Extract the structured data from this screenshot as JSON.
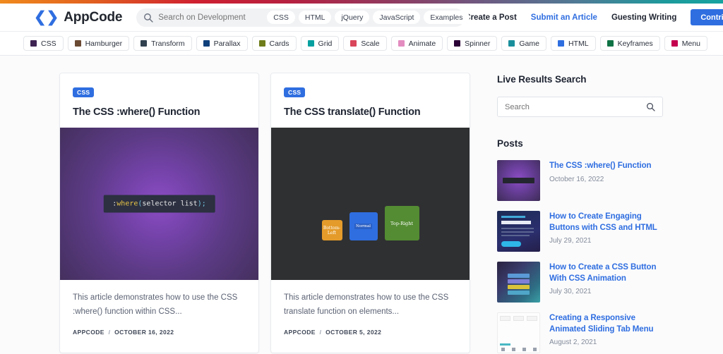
{
  "header": {
    "brand": "AppCode",
    "logo_icon": "code-chevrons-icon",
    "search": {
      "placeholder": "Search on Development",
      "value": "",
      "icon": "search-icon"
    },
    "chips": [
      "CSS",
      "HTML",
      "jQuery",
      "JavaScript",
      "Examples"
    ],
    "nav": [
      {
        "label": "Create a Post",
        "style": "dark"
      },
      {
        "label": "Submit an Article",
        "style": "blue"
      },
      {
        "label": "Guesting Writing",
        "style": "dark"
      }
    ],
    "cta": {
      "label": "Contribute",
      "color": "#2f6ee0"
    }
  },
  "categories": [
    {
      "label": "CSS",
      "color": "#3d2352"
    },
    {
      "label": "Hamburger",
      "color": "#6b4a33"
    },
    {
      "label": "Transform",
      "color": "#31414f"
    },
    {
      "label": "Parallax",
      "color": "#10407c"
    },
    {
      "label": "Cards",
      "color": "#6f7d1a"
    },
    {
      "label": "Grid",
      "color": "#07a0a0"
    },
    {
      "label": "Scale",
      "color": "#d9455a"
    },
    {
      "label": "Animate",
      "color": "#e38cc0"
    },
    {
      "label": "Spinner",
      "color": "#2c0236"
    },
    {
      "label": "Game",
      "color": "#1a8f9c"
    },
    {
      "label": "HTML",
      "color": "#2f6ee0"
    },
    {
      "label": "Keyframes",
      "color": "#0f7245"
    },
    {
      "label": "Menu",
      "color": "#c4004f"
    }
  ],
  "cards": [
    {
      "badge": "CSS",
      "title": "The CSS :where() Function",
      "thumb_kind": "purple-code",
      "code": {
        "colon": ":",
        "keyword": "where",
        "open": "(",
        "args": "selector list",
        "close": ")",
        "semi": ";"
      },
      "excerpt": "This article demonstrates how to use the CSS :where() function within CSS...",
      "author": "APPCODE",
      "date": "OCTOBER 16, 2022"
    },
    {
      "badge": "CSS",
      "title": "The CSS translate() Function",
      "thumb_kind": "dark-squares",
      "squares": [
        {
          "label": "Bottom-Left",
          "color": "#e59b2a"
        },
        {
          "label": "Normal",
          "color": "#2f6ee0"
        },
        {
          "label": "Top-Right",
          "color": "#538c32"
        }
      ],
      "excerpt": "This article demonstrates how to use the CSS translate function on elements...",
      "author": "APPCODE",
      "date": "OCTOBER 5, 2022"
    }
  ],
  "sidebar": {
    "live_search_heading": "Live Results Search",
    "search": {
      "placeholder": "Search",
      "value": "",
      "icon": "search-icon"
    },
    "posts_heading": "Posts",
    "posts": [
      {
        "title": "The CSS :where() Function",
        "date": "October 16, 2022",
        "thumb": "purple-code-thumb"
      },
      {
        "title": "How to Create Engaging Buttons with CSS and HTML",
        "date": "July 29, 2021",
        "thumb": "navy-buttons-thumb"
      },
      {
        "title": "How to Create a CSS Button With CSS Animation",
        "date": "July 30, 2021",
        "thumb": "teal-gradient-thumb"
      },
      {
        "title": "Creating a Responsive Animated Sliding Tab Menu",
        "date": "August 2, 2021",
        "thumb": "white-tabs-thumb"
      }
    ]
  }
}
